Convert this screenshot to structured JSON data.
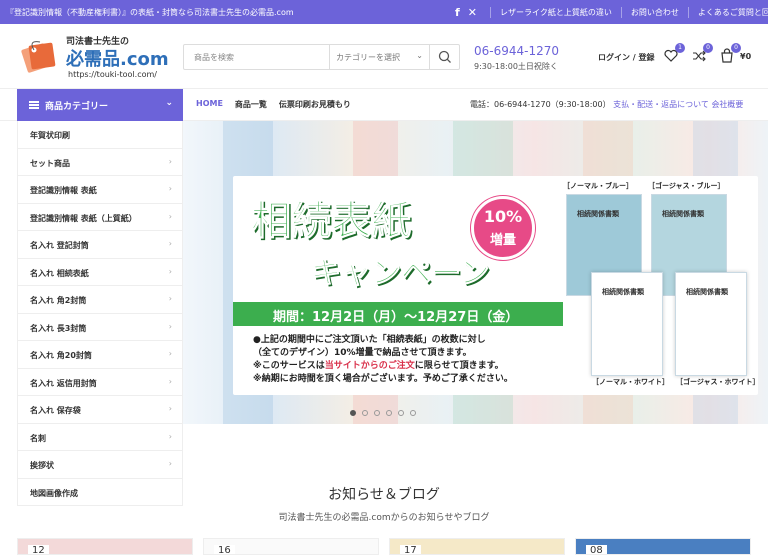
{
  "topbar": {
    "text": "『登記識別情報（不動産権利書）』の表紙・封筒なら司法書士先生の必需品.com",
    "links": [
      "レザーライク紙と上質紙の違い",
      "お問い合わせ",
      "よくあるご質問と回答"
    ]
  },
  "logo": {
    "line1": "司法書士先生の",
    "line2": "必需品.com",
    "url": "https://touki-tool.com/"
  },
  "search": {
    "placeholder": "商品を検索",
    "category": "カテゴリーを選択"
  },
  "contact": {
    "phone": "06-6944-1270",
    "hours": "9:30-18:00土日祝除く"
  },
  "account": {
    "login": "ログイン / 登録",
    "wishlist_count": "1",
    "compare_count": "0",
    "cart_count": "0",
    "cart_total": "¥0"
  },
  "nav": {
    "category_button": "商品カテゴリー",
    "items": [
      "HOME",
      "商品一覧",
      "伝票印刷お見積もり"
    ],
    "right_phone": "電話：06-6944-1270（9:30-18:00）",
    "right_links": [
      "支払・配送・返品について",
      "会社概要"
    ]
  },
  "sidebar": {
    "items": [
      {
        "label": "年賀状印刷",
        "arrow": false
      },
      {
        "label": "セット商品",
        "arrow": true
      },
      {
        "label": "登記識別情報 表紙",
        "arrow": true
      },
      {
        "label": "登記識別情報 表紙（上質紙）",
        "arrow": true
      },
      {
        "label": "名入れ 登記封筒",
        "arrow": true
      },
      {
        "label": "名入れ 相続表紙",
        "arrow": true
      },
      {
        "label": "名入れ 角2封筒",
        "arrow": true
      },
      {
        "label": "名入れ 長3封筒",
        "arrow": true
      },
      {
        "label": "名入れ 角20封筒",
        "arrow": true
      },
      {
        "label": "名入れ 返信用封筒",
        "arrow": true
      },
      {
        "label": "名入れ 保存袋",
        "arrow": true
      },
      {
        "label": "名刺",
        "arrow": true
      },
      {
        "label": "挨拶状",
        "arrow": true
      },
      {
        "label": "地図画像作成",
        "arrow": false
      }
    ]
  },
  "banner": {
    "title1": "相続表紙",
    "title2": "キャンペーン",
    "badge_pct": "10%",
    "badge_word": "増量",
    "period": "期間：12月2日（月）～12月27日（金）",
    "line1": "●上記の期間中にご注文頂いた「相続表紙」の枚数に対し",
    "line2": "（全てのデザイン）10%増量で納品させて頂きます。",
    "line3_a": "※このサービスは",
    "line3_red": "当サイトからのご注文",
    "line3_b": "に限らせて頂きます。",
    "line4": "※納期にお時間を頂く場合がございます。予めご了承ください。",
    "doc_title": "相続関係書類",
    "docs": [
      "［ノーマル・ブルー］",
      "［ゴージャス・ブルー］",
      "［ノーマル・ホワイト］",
      "［ゴージャス・ホワイト］"
    ]
  },
  "slider": {
    "count": 6,
    "active": 0
  },
  "news": {
    "title": "お知らせ＆ブログ",
    "subtitle": "司法書士先生の必需品.comからのお知らせやブログ",
    "cards": [
      {
        "date": "12"
      },
      {
        "date": "16"
      },
      {
        "date": "17"
      },
      {
        "date": "08"
      }
    ]
  },
  "colors": {
    "accent": "#6c63d9",
    "green": "#3cae4e",
    "pink": "#e74a87"
  }
}
